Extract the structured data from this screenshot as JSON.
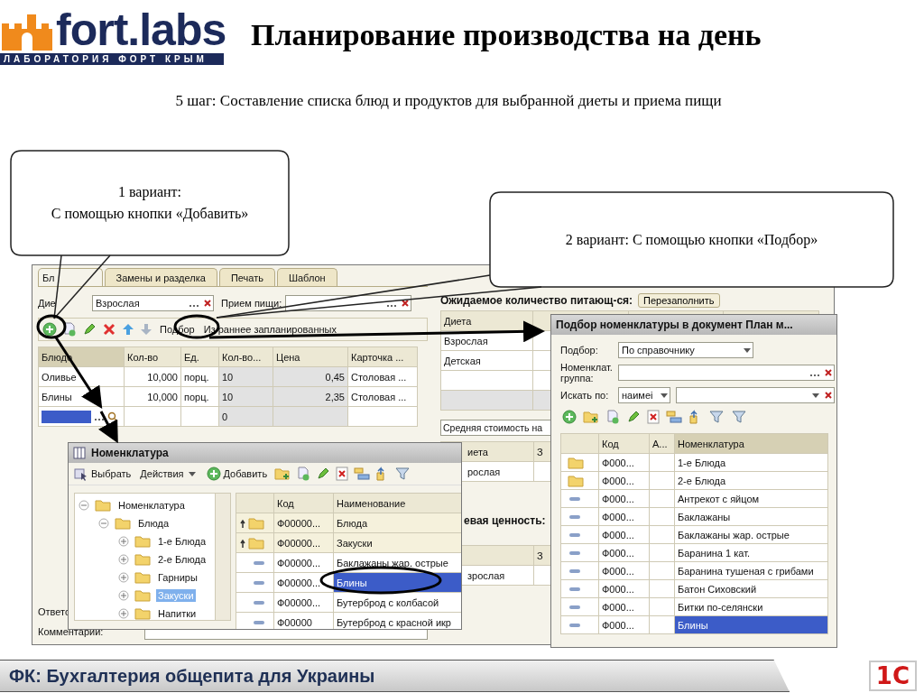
{
  "header": {
    "logo_name": "fort.labs",
    "logo_tagline": "ЛАБОРАТОРИЯ ФОРТ КРЫМ",
    "title": "Планирование производства на день"
  },
  "step": "5 шаг: Составление списка блюд и продуктов для выбранной диеты и приема пищи",
  "callouts": [
    {
      "lines": [
        "1 вариант:",
        "С помощью кнопки «Добавить»"
      ]
    },
    {
      "lines": [
        "2 вариант: С помощью кнопки «Подбор»"
      ]
    }
  ],
  "document_window": {
    "tabs": [
      {
        "label": "Бл",
        "selected": true
      },
      {
        "label": "Замены и разделка",
        "selected": false
      },
      {
        "label": "Печать",
        "selected": false
      },
      {
        "label": "Шаблон",
        "selected": false
      }
    ],
    "diet_label": "Дие",
    "diet_value": "Взрослая",
    "meal_label": "Прием пищи:",
    "toolbar_buttons": [
      "Подбор",
      "Из раннее запланированных"
    ],
    "table": {
      "columns": [
        "Блюдо",
        "Кол-во",
        "Ед.",
        "Кол-во...",
        "Цена",
        "Карточка ..."
      ],
      "rows": [
        {
          "kind": "row",
          "cells": [
            "Оливье",
            "10,000",
            "порц.",
            "10",
            "0,45",
            "Столовая ..."
          ]
        },
        {
          "kind": "row",
          "cells": [
            "Блины",
            "10,000",
            "порц.",
            "10",
            "2,35",
            "Столовая ..."
          ]
        },
        {
          "kind": "edit",
          "cells": [
            null,
            null,
            null,
            "0",
            null,
            null
          ]
        }
      ]
    },
    "expected_label": "Ожидаемое количество питающ-ся:",
    "refill_button": "Перезаполнить",
    "diet_table": {
      "column": "Диета",
      "rows": [
        "Взрослая",
        "Детская"
      ]
    },
    "avg_cost_label": "Средняя стоимость на",
    "second_table": {
      "columns": [
        "иета",
        "З"
      ],
      "rows": [
        "рослая"
      ]
    },
    "nutrition_label": "евая ценность:",
    "third_table": {
      "columns": [
        "З"
      ],
      "rows": [
        "зрослая"
      ]
    },
    "response_label": "Ответс",
    "comment_label": "Комментарий:"
  },
  "nomenclature_window": {
    "title": "Номенклатура",
    "toolbar_buttons": [
      "Выбрать",
      "Действия",
      "Добавить"
    ],
    "tree": [
      {
        "label": "Номенклатура",
        "expanded": true,
        "selected": false,
        "children": [
          {
            "label": "Блюда",
            "expanded": true,
            "selected": false,
            "children": [
              {
                "label": "1-е Блюда",
                "expanded": false,
                "selected": false
              },
              {
                "label": "2-е Блюда",
                "expanded": false,
                "selected": false
              },
              {
                "label": "Гарниры",
                "expanded": false,
                "selected": false
              },
              {
                "label": "Закуски",
                "expanded": false,
                "selected": true
              },
              {
                "label": "Напитки",
                "expanded": false,
                "selected": false
              }
            ]
          }
        ]
      }
    ],
    "columns": [
      "Код",
      "Наименование"
    ],
    "rows": [
      {
        "kind": "group",
        "code": "Ф00000...",
        "name": "Блюда",
        "selected": false
      },
      {
        "kind": "group",
        "code": "Ф00000...",
        "name": "Закуски",
        "selected": false
      },
      {
        "kind": "item",
        "code": "Ф00000...",
        "name": "Баклажаны жар. острые",
        "selected": false
      },
      {
        "kind": "item",
        "code": "Ф00000...",
        "name": "Блины",
        "selected": true
      },
      {
        "kind": "item",
        "code": "Ф00000...",
        "name": "Бутерброд с колбасой",
        "selected": false
      },
      {
        "kind": "item",
        "code": "Ф00000",
        "name": "Бутерброд с красной икр",
        "selected": false
      }
    ]
  },
  "selection_window": {
    "title": "Подбор номенклатуры в документ План м...",
    "selection_label": "Подбор:",
    "selection_value": "По справочнику",
    "group_label": "Номенклат. группа:",
    "search_label": "Искать по:",
    "search_value": "наимеі",
    "columns": [
      "Код",
      "А...",
      "Номенклатура"
    ],
    "rows": [
      {
        "kind": "folder",
        "code": "Ф000...",
        "name": "1-е Блюда",
        "selected": false
      },
      {
        "kind": "folder",
        "code": "Ф000...",
        "name": "2-е Блюда",
        "selected": false
      },
      {
        "kind": "item",
        "code": "Ф000...",
        "name": "Антрекот с яйцом",
        "selected": false
      },
      {
        "kind": "item",
        "code": "Ф000...",
        "name": "Баклажаны",
        "selected": false
      },
      {
        "kind": "item",
        "code": "Ф000...",
        "name": "Баклажаны жар. острые",
        "selected": false
      },
      {
        "kind": "item",
        "code": "Ф000...",
        "name": "Баранина 1 кат.",
        "selected": false
      },
      {
        "kind": "item",
        "code": "Ф000...",
        "name": "Баранина тушеная с грибами",
        "selected": false
      },
      {
        "kind": "item",
        "code": "Ф000...",
        "name": "Батон Сиховский",
        "selected": false
      },
      {
        "kind": "item",
        "code": "Ф000...",
        "name": "Битки по-селянски",
        "selected": false
      },
      {
        "kind": "item",
        "code": "Ф000...",
        "name": "Блины",
        "selected": true
      }
    ]
  },
  "footer": {
    "title": "ФК: Бухгалтерия общепита для Украины",
    "logo_text": "1С"
  }
}
